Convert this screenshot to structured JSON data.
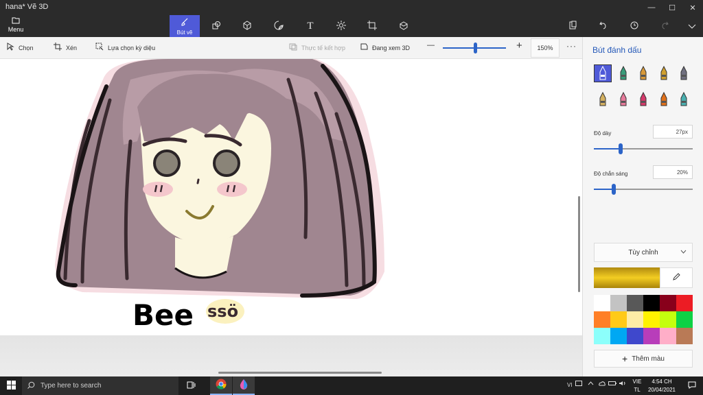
{
  "window": {
    "title": "hana*   Vẽ 3D",
    "controls": {
      "minimize": "—",
      "maximize": "☐",
      "close": "✕"
    }
  },
  "ribbon": {
    "menu_icon": "folder-icon",
    "menu_label": "Menu",
    "active_tool_label": "Bút vẽ",
    "tools": [
      "brush-icon",
      "2d-shapes-icon",
      "3d-shapes-icon",
      "stickers-icon",
      "text-icon",
      "effects-icon",
      "canvas-icon",
      "3d-library-icon"
    ],
    "right_tools": [
      "paste-icon",
      "undo-icon",
      "history-icon",
      "redo-icon",
      "expand-icon"
    ],
    "text_tool_glyph": "T"
  },
  "toolbar": {
    "select_label": "Chọn",
    "crop_label": "Xén",
    "magic_select_label": "Lựa chọn kỳ diệu",
    "mixed_reality_label": "Thực tế kết hợp",
    "view_3d_label": "Đang xem 3D",
    "zoom_minus": "—",
    "zoom_plus": "+",
    "zoom_value": "150%",
    "more": "···"
  },
  "drawing": {
    "handwritten_text_1": "Bee",
    "handwritten_text_2": "ssö"
  },
  "panel": {
    "title": "Bút đánh dấu",
    "brushes": [
      {
        "name": "marker-brush",
        "color": "#6a7cc8",
        "selected": true
      },
      {
        "name": "calligraphy-pen",
        "color": "#3a9c7a"
      },
      {
        "name": "oil-brush",
        "color": "#d89a3a"
      },
      {
        "name": "watercolor-brush",
        "color": "#d0a030"
      },
      {
        "name": "pixel-pen",
        "color": "#707080"
      },
      {
        "name": "pencil",
        "color": "#d4b060"
      },
      {
        "name": "eraser",
        "color": "#e67a9a"
      },
      {
        "name": "crayon",
        "color": "#d43a6a"
      },
      {
        "name": "spray-can",
        "color": "#e0701a"
      },
      {
        "name": "fill-bucket",
        "color": "#4ab0b0"
      }
    ],
    "thickness_label": "Độ dày",
    "thickness_value": "27px",
    "thickness_fraction": 0.27,
    "opacity_label": "Độ chắn sáng",
    "opacity_value": "20%",
    "opacity_fraction": 0.2,
    "dropdown_label": "Tùy chỉnh",
    "current_color": "#e8c020",
    "swatches": [
      "#ffffff",
      "#c3c3c3",
      "#585858",
      "#000000",
      "#88001b",
      "#ec1c24",
      "#ff7f27",
      "#ffca18",
      "#fdeca6",
      "#fff200",
      "#c4ff0e",
      "#0ed145",
      "#8cfffb",
      "#00a8f3",
      "#3f48cc",
      "#b83dba",
      "#ffaec8",
      "#b97a56"
    ],
    "add_color_label": "Thêm màu"
  },
  "taskbar": {
    "search_placeholder": "Type here to search",
    "tray_lang": "VI",
    "lang_top": "VIE",
    "lang_bottom": "TL",
    "time": "4:54 CH",
    "date": "20/04/2021"
  }
}
